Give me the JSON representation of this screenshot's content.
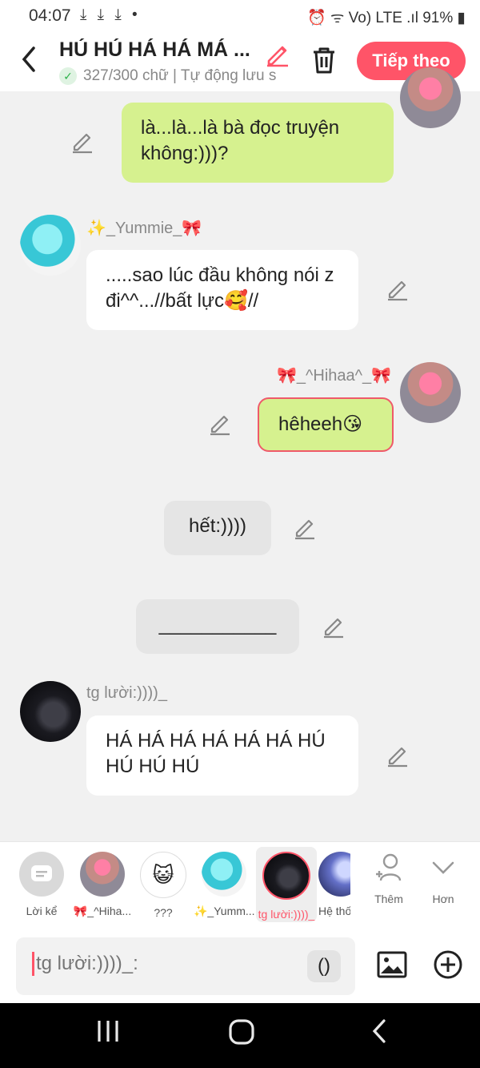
{
  "status_bar": {
    "time": "04:07",
    "left_icons": "⤓ ⤓ ⤓ •",
    "right_icons": "⏰ ᯤ Vo) LTE .ıl",
    "battery": "91%"
  },
  "header": {
    "title": "HÚ HÚ HÁ HÁ MÁ ...",
    "subtitle": "327/300 chữ | Tự động lưu s",
    "next_button": "Tiếp theo"
  },
  "messages": [
    {
      "speaker": "",
      "text": "là...là...là bà đọc truyện không:)))?",
      "style": "green"
    },
    {
      "speaker": "✨_Yummie_🎀",
      "text": ".....sao lúc đầu không nói z đi^^...//bất lực🥰//",
      "style": "white"
    },
    {
      "speaker": "🎀_^Hihaa^_🎀",
      "text": "hêheeh😘",
      "style": "green-selected"
    },
    {
      "speaker": "",
      "text": "hết:))))",
      "style": "narration"
    },
    {
      "speaker": "",
      "text": "___________",
      "style": "narration"
    },
    {
      "speaker": "tg lười:))))_",
      "text": "HÁ HÁ HÁ HÁ HÁ HÁ HÚ HÚ HÚ HÚ",
      "style": "white"
    }
  ],
  "characters": [
    {
      "label": "Lời kể"
    },
    {
      "label": "🎀_^Hiha..."
    },
    {
      "label": "???"
    },
    {
      "label": "✨_Yumm..."
    },
    {
      "label": "tg lười:))))_"
    },
    {
      "label": "Hệ thố"
    }
  ],
  "actions": {
    "add_label": "Thêm",
    "more_label": "Hơn"
  },
  "input": {
    "placeholder": "tg lười:))))_:",
    "paren_button": "()"
  },
  "colors": {
    "accent": "#ff5468",
    "bubble_green": "#d6f18f",
    "bubble_white": "#ffffff",
    "narration_gray": "#e5e5e5"
  }
}
